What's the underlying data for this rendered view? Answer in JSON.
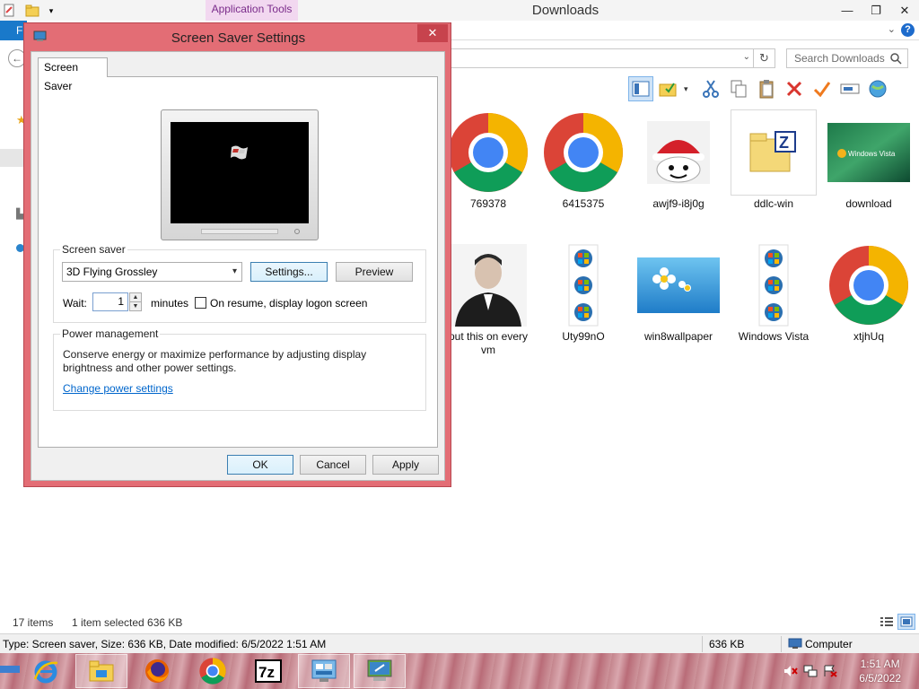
{
  "explorer": {
    "title": "Downloads",
    "contextual_tab": "Application Tools",
    "ribbon": {
      "file_tab": "F"
    },
    "search": {
      "placeholder": "Search Downloads"
    },
    "files": [
      {
        "name": "769378",
        "icon": "chrome-icon"
      },
      {
        "name": "6415375",
        "icon": "chrome-icon"
      },
      {
        "name": "awjf9-i8j0g",
        "icon": "santa-ghost-image"
      },
      {
        "name": "ddlc-win",
        "icon": "zip-folder-icon",
        "selected": true
      },
      {
        "name": "download",
        "icon": "windows-vista-wallpaper"
      },
      {
        "name": "put this on every vm",
        "icon": "portrait-photo"
      },
      {
        "name": "Uty99nO",
        "icon": "windows-orb-icons"
      },
      {
        "name": "win8wallpaper",
        "icon": "daisies-wallpaper"
      },
      {
        "name": "Windows Vista",
        "icon": "windows-orb-icons"
      },
      {
        "name": "xtjhUq",
        "icon": "chrome-icon"
      }
    ],
    "status": {
      "items": "17 items",
      "selected": "1 item selected  636 KB"
    },
    "details": {
      "info": "Type: Screen saver, Size: 636 KB, Date modified: 6/5/2022 1:51 AM",
      "size": "636 KB",
      "location": "Computer"
    }
  },
  "dialog": {
    "title": "Screen Saver Settings",
    "tab": "Screen Saver",
    "screen_saver_group": {
      "label": "Screen saver",
      "selected": "3D Flying Grossley",
      "settings_button": "Settings...",
      "preview_button": "Preview",
      "wait_label": "Wait:",
      "wait_value": "1",
      "minutes_label": "minutes",
      "resume_label": "On resume, display logon screen"
    },
    "power_group": {
      "label": "Power management",
      "description": "Conserve energy or maximize performance by adjusting display brightness and other power settings.",
      "link": "Change power settings"
    },
    "buttons": {
      "ok": "OK",
      "cancel": "Cancel",
      "apply": "Apply"
    }
  },
  "taskbar": {
    "apps": [
      "internet-explorer-icon",
      "file-explorer-icon",
      "firefox-icon",
      "chrome-icon",
      "7zip-icon",
      "control-panel-icon",
      "screen-saver-dialog-icon"
    ],
    "clock": {
      "time": "1:51 AM",
      "date": "6/5/2022"
    }
  },
  "colors": {
    "dialog_frame": "#e36d75",
    "accent": "#1979ca",
    "taskbar": "#c4858d"
  }
}
